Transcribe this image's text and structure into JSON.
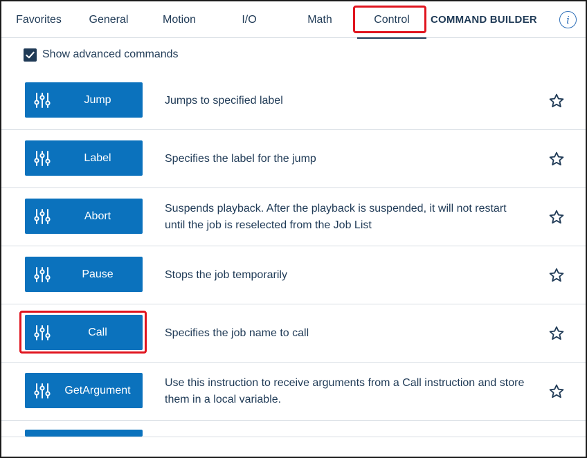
{
  "tabs": [
    {
      "label": "Favorites"
    },
    {
      "label": "General"
    },
    {
      "label": "Motion"
    },
    {
      "label": "I/O"
    },
    {
      "label": "Math"
    },
    {
      "label": "Control"
    }
  ],
  "header": {
    "title": "COMMAND BUILDER",
    "info_glyph": "i"
  },
  "options": {
    "show_advanced_label": "Show advanced commands",
    "show_advanced_checked": true
  },
  "commands": [
    {
      "label": "Jump",
      "description": "Jumps to specified label"
    },
    {
      "label": "Label",
      "description": "Specifies the label for the jump"
    },
    {
      "label": "Abort",
      "description": "Suspends playback. After the playback is suspended, it will not restart until the job is reselected from the Job List"
    },
    {
      "label": "Pause",
      "description": "Stops the job temporarily"
    },
    {
      "label": "Call",
      "description": "Specifies the job name to call"
    },
    {
      "label": "GetArgument",
      "description": "Use this instruction to receive arguments from a Call instruction and store them in a local variable."
    }
  ],
  "colors": {
    "accent": "#0b72bd",
    "text": "#1f3a56",
    "highlight": "#e0141e",
    "info": "#2e6fb8"
  },
  "icons": {
    "command": "sliders-icon",
    "favorite": "star-outline-icon",
    "check": "checkmark-icon",
    "info": "info-icon"
  }
}
